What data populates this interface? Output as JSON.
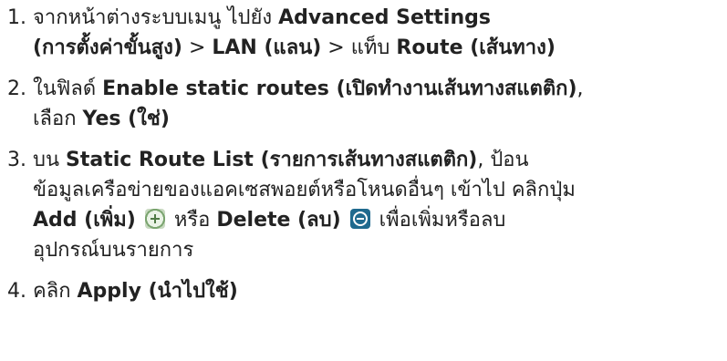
{
  "steps": [
    {
      "number": "1.",
      "lines": [
        [
          "จากหน้าต่างระบบเมนู ไปยัง ",
          {
            "b": "Advanced Settings"
          }
        ],
        [
          {
            "b": "(การตั้งค่าขั้นสูง)"
          },
          " > ",
          {
            "b": "LAN (แลน)"
          },
          " > แท็บ ",
          {
            "b": "Route (เส้นทาง)"
          }
        ]
      ]
    },
    {
      "number": "2.",
      "lines": [
        [
          "ในฟิลด์ ",
          {
            "b": "Enable static routes (เปิดทำงานเส้นทางสแตติก)"
          },
          ","
        ],
        [
          "เลือก ",
          {
            "b": "Yes (ใช่)"
          }
        ]
      ]
    },
    {
      "number": "3.",
      "lines": [
        [
          "บน ",
          {
            "b": "Static Route List (รายการเส้นทางสแตติก)"
          },
          ", ป้อน"
        ],
        [
          "ข้อมูลเครือข่ายของแอคเซสพอยต์หรือโหนดอื่นๆ เข้าไป คลิกปุ่ม"
        ],
        [
          {
            "b": "Add (เพิ่ม)"
          },
          " ",
          {
            "icon": "add-icon"
          },
          " หรือ ",
          {
            "b": "Delete (ลบ)"
          },
          " ",
          {
            "icon": "delete-icon"
          },
          " เพื่อเพิ่มหรือลบ"
        ],
        [
          "อุปกรณ์บนรายการ"
        ]
      ]
    },
    {
      "number": "4.",
      "lines": [
        [
          "คลิก ",
          {
            "b": "Apply (นำไปใช้)"
          }
        ]
      ]
    }
  ]
}
